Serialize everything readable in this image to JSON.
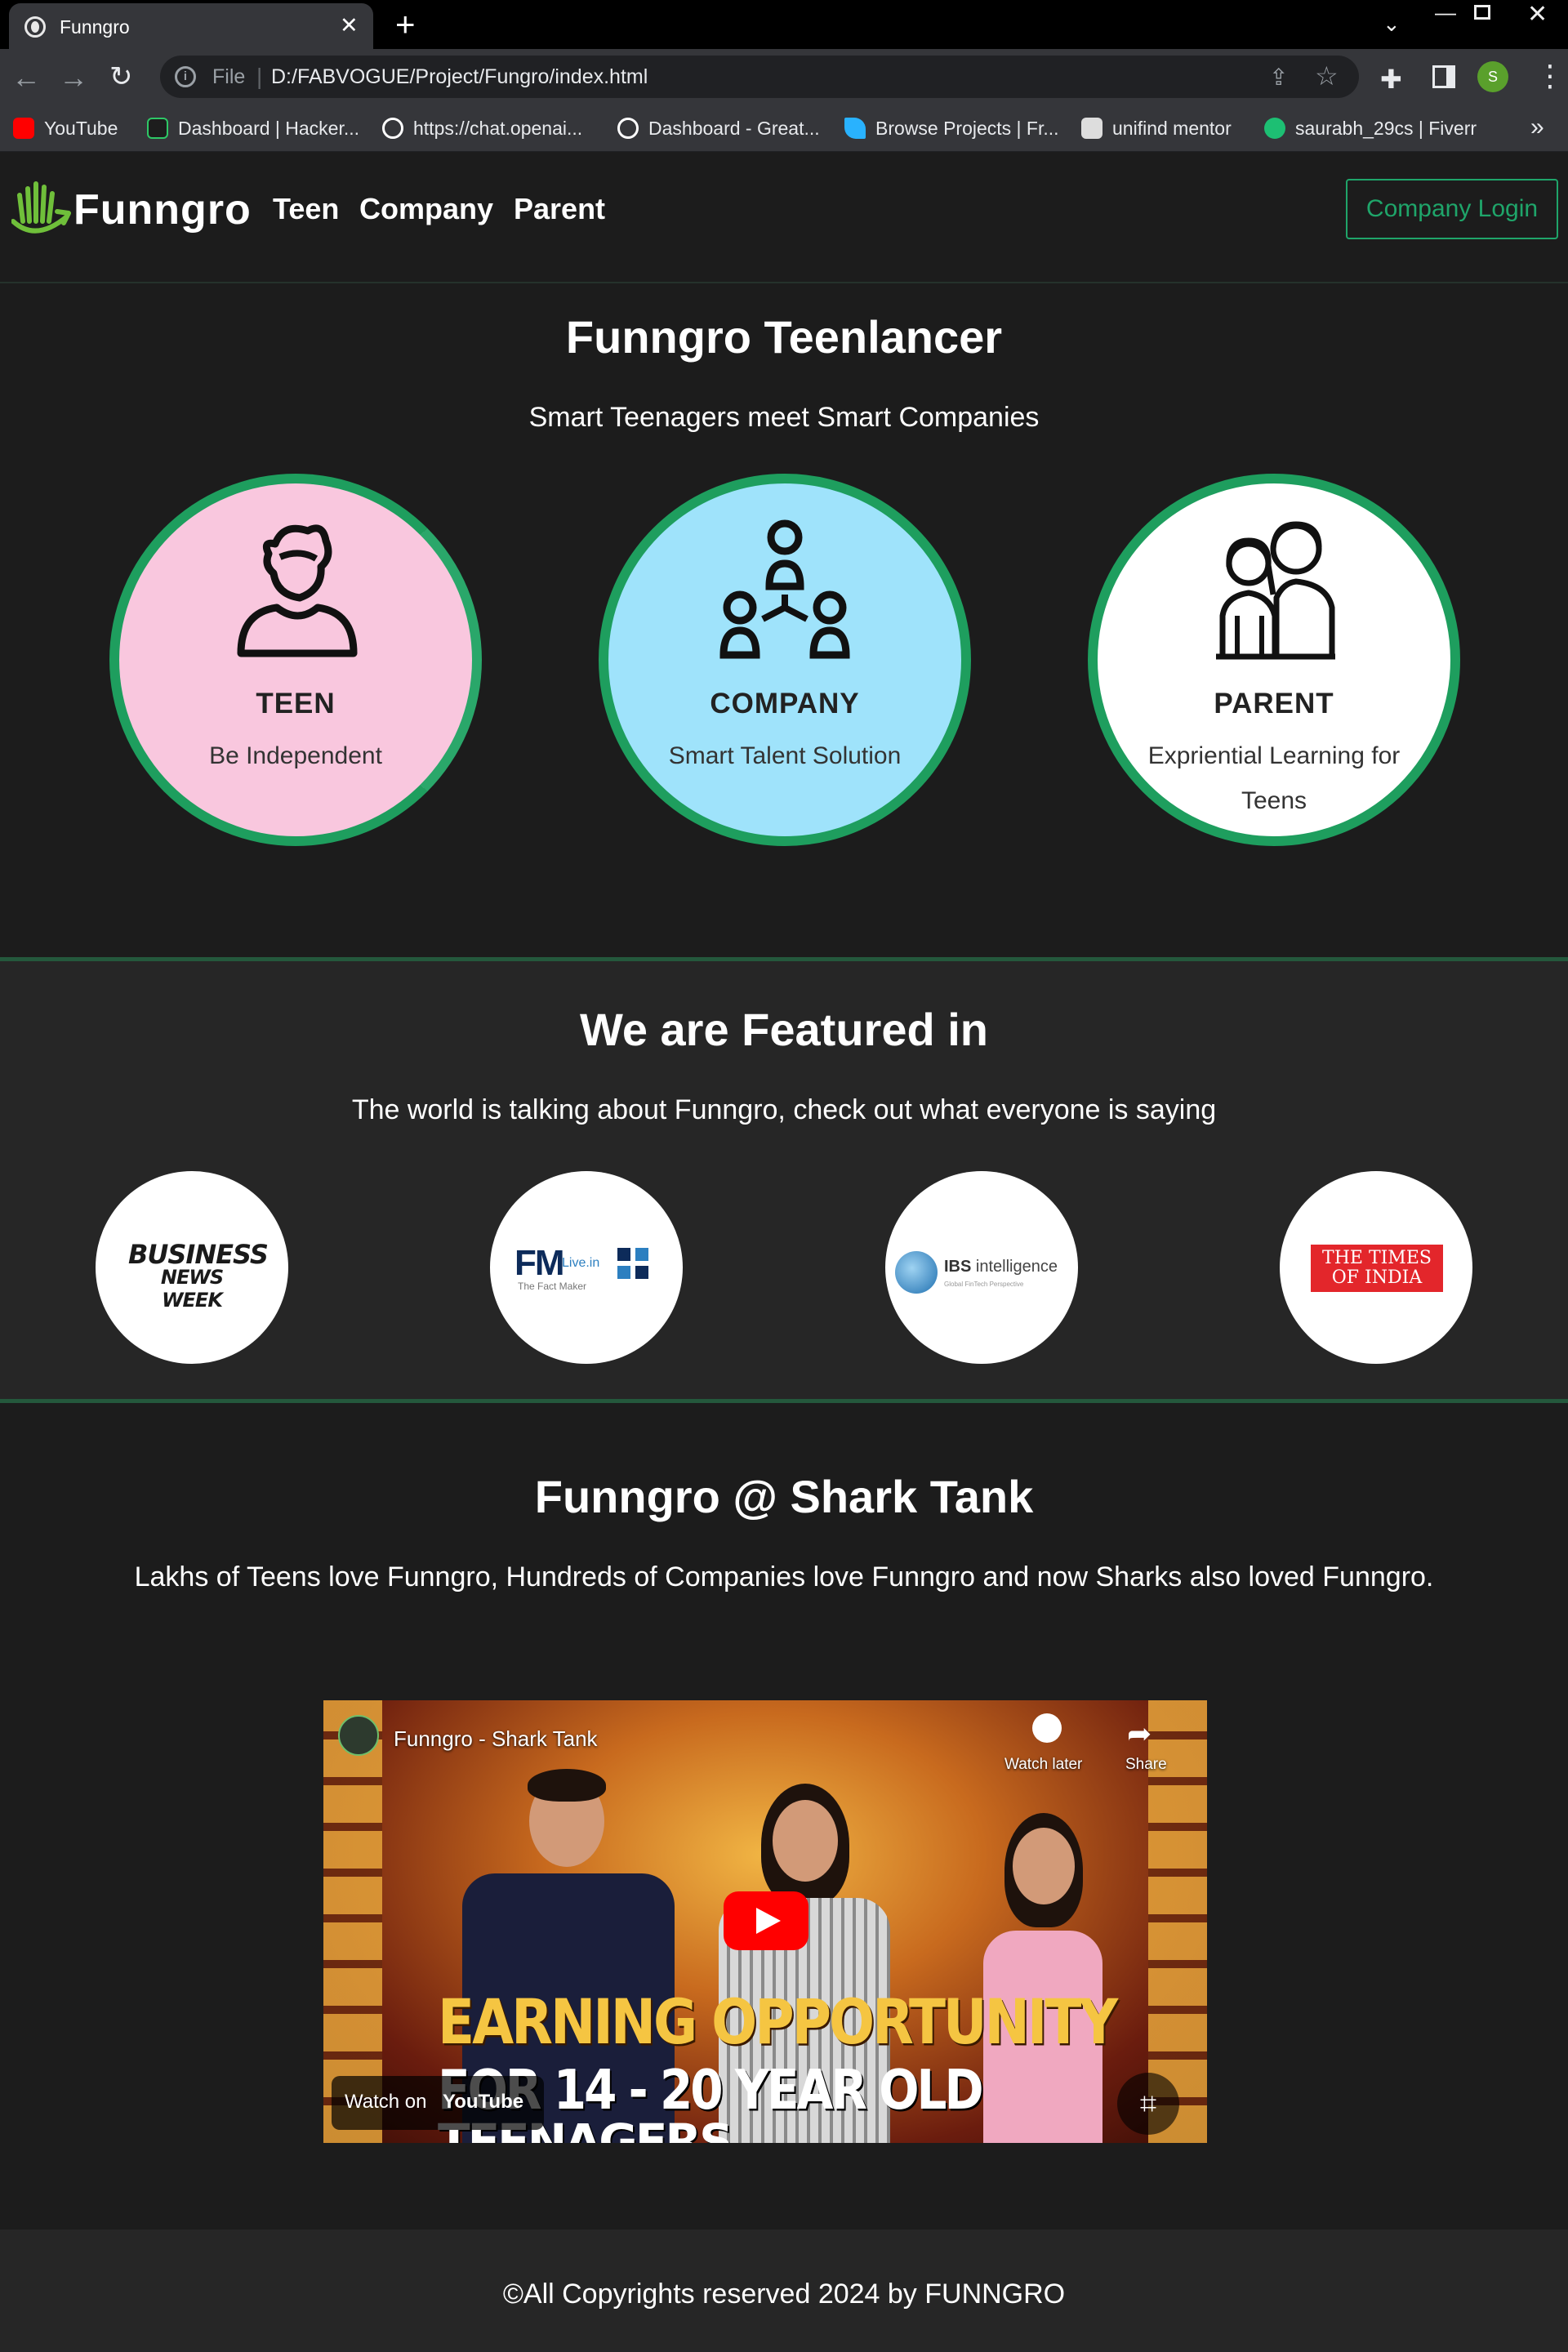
{
  "browser": {
    "tab_title": "Funngro",
    "url_scheme": "File",
    "url": "D:/FABVOGUE/Project/Fungro/index.html",
    "profile_initial": "S",
    "bookmarks": [
      {
        "label": "YouTube",
        "color": "#ff0000"
      },
      {
        "label": "Dashboard | Hacker...",
        "color": "#2ec866"
      },
      {
        "label": "https://chat.openai...",
        "color": "#ffffff"
      },
      {
        "label": "Dashboard - Great...",
        "color": "#ffffff"
      },
      {
        "label": "Browse Projects | Fr...",
        "color": "#29b2fe"
      },
      {
        "label": "unifind mentor",
        "color": "#dddddd"
      },
      {
        "label": "saurabh_29cs | Fiverr",
        "color": "#1dbf73"
      }
    ]
  },
  "site": {
    "logo_text": "Funngro",
    "nav": [
      "Teen",
      "Company",
      "Parent"
    ],
    "login_label": "Company Login",
    "accent": "#1fa56a"
  },
  "hero": {
    "title": "Funngro Teenlancer",
    "subtitle": "Smart Teenagers meet Smart Companies",
    "cards": [
      {
        "title": "TEEN",
        "desc": "Be Independent",
        "color": "#f9c7de",
        "icon": "teen-icon"
      },
      {
        "title": "COMPANY",
        "desc": "Smart Talent Solution",
        "color": "#9fe3fb",
        "icon": "company-network-icon"
      },
      {
        "title": "PARENT",
        "desc": "Expriential Learning for Teens",
        "color": "#ffffff",
        "icon": "parent-family-icon"
      }
    ]
  },
  "featured": {
    "title": "We are Featured in",
    "subtitle": "The world is talking about Funngro, check out what everyone is saying",
    "logos": {
      "bnw_line1": "BUSINESS",
      "bnw_line2": "NEWS WEEK",
      "fm": "FM",
      "fm_live": "Live.in",
      "fm_tag": "The Fact Maker",
      "ibs": "IBS",
      "ibs_suffix": "intelligence",
      "ibs_tag": "Global FinTech Perspective",
      "toi_line1": "THE TIMES",
      "toi_line2": "OF INDIA"
    }
  },
  "shark": {
    "title": "Funngro @ Shark Tank",
    "subtitle": "Lakhs of Teens love Funngro, Hundreds of Companies love Funngro and now Sharks also loved Funngro.",
    "video": {
      "title": "Funngro - Shark Tank",
      "watch_later": "Watch later",
      "share": "Share",
      "caption_line1": "EARNING OPPORTUNITY",
      "caption_line2": "FOR 14 - 20 YEAR OLD",
      "caption_line3": "TEENAGERS",
      "watch_on": "Watch on",
      "youtube": "YouTube"
    }
  },
  "footer": {
    "text": "©All Copyrights reserved 2024 by FUNNGRO"
  }
}
